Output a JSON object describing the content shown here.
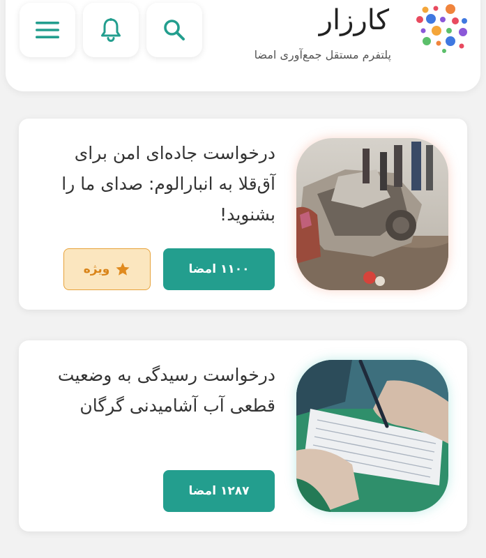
{
  "header": {
    "title": "کارزار",
    "subtitle": "پلتفرم مستقل جمع‌آوری امضا",
    "icons": [
      "menu-icon",
      "bell-icon",
      "search-icon",
      "logo-dots-icon"
    ]
  },
  "petitions": [
    {
      "title": "درخواست جاده‌ای امن برای آق‌قلا به انبارالوم: صدای ما را بشنوید!",
      "signatures_label": "۱۱۰۰ امضا",
      "signatures": 1100,
      "badge_label": "ویژه",
      "badge_icon": "star-icon",
      "image": "car-accident-photo"
    },
    {
      "title": "درخواست رسیدگی به وضعیت قطعی آب آشامیدنی گرگان",
      "signatures_label": "۱۲۸۷ امضا",
      "signatures": 1287,
      "image": "signing-petition-photo"
    }
  ],
  "colors": {
    "accent": "#239e8e",
    "badge_bg": "#fbe6bf",
    "badge_border": "#e7a23a",
    "badge_text": "#d98419",
    "background": "#f2f2f2"
  }
}
